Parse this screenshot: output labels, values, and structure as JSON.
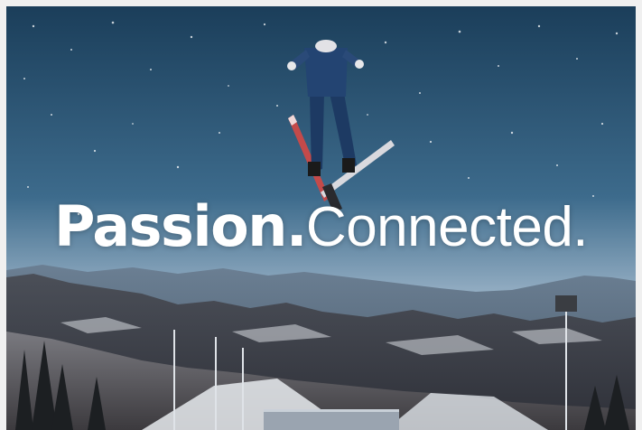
{
  "headline": {
    "part1": "Passion.",
    "part2": "Connected."
  },
  "colors": {
    "sky_top": "#1b3e5a",
    "sky_mid": "#3d6b8c",
    "sky_horizon": "#9cb4c8",
    "text": "#ffffff",
    "page_background": "#f0f0f0"
  },
  "icons": {
    "athlete": "ski-jumper-icon"
  }
}
